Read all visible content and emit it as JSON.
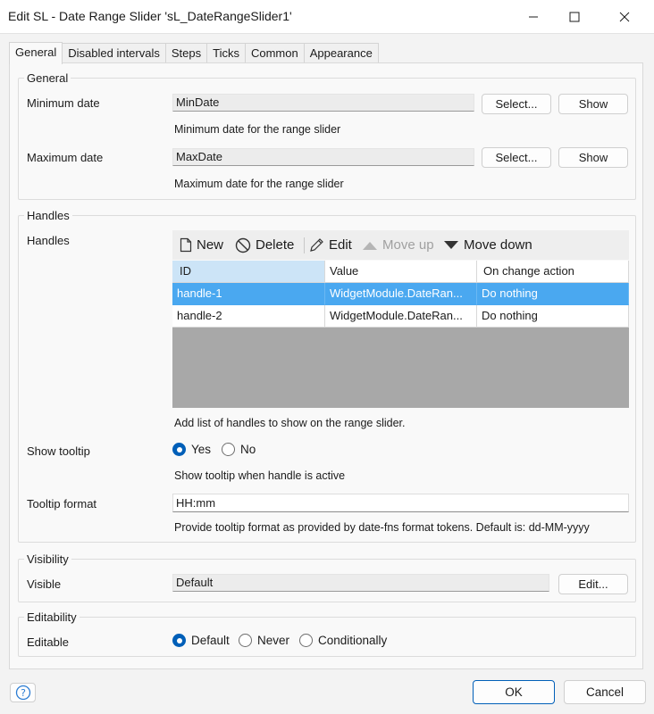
{
  "window": {
    "title": "Edit SL - Date Range Slider 'sL_DateRangeSlider1'"
  },
  "tabs": [
    "General",
    "Disabled intervals",
    "Steps",
    "Ticks",
    "Common",
    "Appearance"
  ],
  "general": {
    "legend": "General",
    "min_label": "Minimum date",
    "min_value": "MinDate",
    "min_hint": "Minimum date for the range slider",
    "max_label": "Maximum date",
    "max_value": "MaxDate",
    "max_hint": "Maximum date for the range slider",
    "select_label": "Select...",
    "show_label": "Show"
  },
  "handles": {
    "legend": "Handles",
    "label": "Handles",
    "toolbar": {
      "new": "New",
      "delete": "Delete",
      "edit": "Edit",
      "move_up": "Move up",
      "move_down": "Move down"
    },
    "columns": [
      "ID",
      "Value",
      "On change action"
    ],
    "rows": [
      [
        "handle-1",
        "WidgetModule.DateRan...",
        "Do nothing"
      ],
      [
        "handle-2",
        "WidgetModule.DateRan...",
        "Do nothing"
      ]
    ],
    "hint": "Add list of handles to show on the range slider.",
    "tooltip_label": "Show tooltip",
    "tooltip_yes": "Yes",
    "tooltip_no": "No",
    "tooltip_hint": "Show tooltip when handle is active",
    "format_label": "Tooltip format",
    "format_value": "HH:mm",
    "format_hint": "Provide tooltip format as provided by date-fns format tokens. Default is: dd-MM-yyyy"
  },
  "visibility": {
    "legend": "Visibility",
    "label": "Visible",
    "value": "Default",
    "edit_label": "Edit..."
  },
  "editability": {
    "legend": "Editability",
    "label": "Editable",
    "options": [
      "Default",
      "Never",
      "Conditionally"
    ]
  },
  "footer": {
    "ok": "OK",
    "cancel": "Cancel",
    "help_glyph": "?"
  },
  "colors": {
    "accent": "#005fb8",
    "selected_row": "#4aa8f0",
    "sorted_header": "#cce4f7"
  },
  "icons": [
    "close-icon",
    "maximize-icon",
    "minimize-icon",
    "new-document-icon",
    "delete-icon",
    "edit-pencil-icon",
    "triangle-up-icon",
    "triangle-down-icon",
    "help-icon"
  ]
}
